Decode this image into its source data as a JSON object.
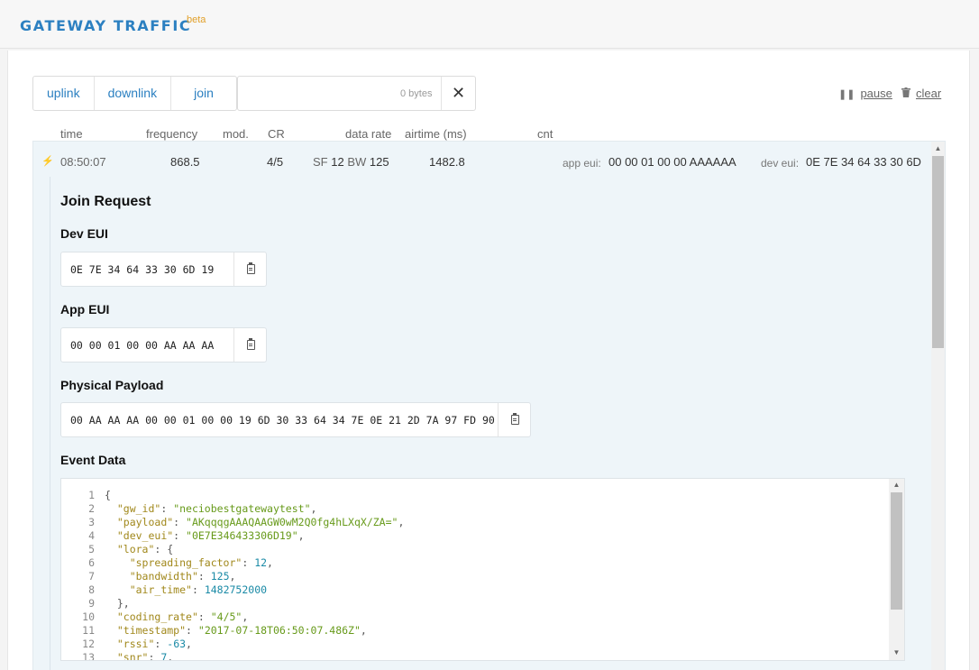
{
  "header": {
    "title": "GATEWAY TRAFFIC",
    "badge": "beta"
  },
  "filters": [
    {
      "label": "uplink"
    },
    {
      "label": "downlink"
    },
    {
      "label": "join"
    }
  ],
  "bytes_filter": {
    "placeholder": "0 bytes",
    "clear_glyph": "✕"
  },
  "toolbar": {
    "pause_label": "pause",
    "clear_label": "clear",
    "pause_icon": "pause-icon",
    "clear_icon": "trash-icon"
  },
  "columns": {
    "time": "time",
    "frequency": "frequency",
    "mod": "mod.",
    "cr": "CR",
    "data_rate": "data rate",
    "airtime": "airtime (ms)",
    "cnt": "cnt"
  },
  "row": {
    "icon": "bolt-icon",
    "time": "08:50:07",
    "frequency": "868.5",
    "cr": "4/5",
    "sf_label": "SF",
    "sf_value": "12",
    "bw_label": "BW",
    "bw_value": "125",
    "airtime": "1482.8",
    "app_eui_label": "app eui:",
    "app_eui": "00 00 01 00 00 AAAAAA",
    "dev_eui_label": "dev eui:",
    "dev_eui": "0E 7E 34 64 33 30 6D"
  },
  "detail": {
    "title": "Join Request",
    "dev_eui_title": "Dev EUI",
    "dev_eui_value": "0E 7E 34 64 33 30 6D 19",
    "app_eui_title": "App EUI",
    "app_eui_value": "00 00 01 00 00 AA AA AA",
    "payload_title": "Physical Payload",
    "payload_value": "00 AA AA AA 00 00 01 00 00 19 6D 30 33 64 34 7E 0E 21 2D 7A 97 FD 90",
    "event_title": "Event Data"
  },
  "event_json": [
    {
      "n": "1",
      "text": "{"
    },
    {
      "n": "2",
      "key": "\"gw_id\"",
      "val": "\"neciobestgatewaytest\"",
      "vt": "str",
      "indent": 2,
      "comma": true
    },
    {
      "n": "3",
      "key": "\"payload\"",
      "val": "\"AKqqqgAAAQAAGW0wM2Q0fg4hLXqX/ZA=\"",
      "vt": "str",
      "indent": 2,
      "comma": true
    },
    {
      "n": "4",
      "key": "\"dev_eui\"",
      "val": "\"0E7E346433306D19\"",
      "vt": "str",
      "indent": 2,
      "comma": true
    },
    {
      "n": "5",
      "key": "\"lora\"",
      "val": "{",
      "vt": "p",
      "indent": 2,
      "comma": false
    },
    {
      "n": "6",
      "key": "\"spreading_factor\"",
      "val": "12",
      "vt": "num",
      "indent": 4,
      "comma": true
    },
    {
      "n": "7",
      "key": "\"bandwidth\"",
      "val": "125",
      "vt": "num",
      "indent": 4,
      "comma": true
    },
    {
      "n": "8",
      "key": "\"air_time\"",
      "val": "1482752000",
      "vt": "num",
      "indent": 4,
      "comma": false
    },
    {
      "n": "9",
      "text": "  },",
      "indent": 0
    },
    {
      "n": "10",
      "key": "\"coding_rate\"",
      "val": "\"4/5\"",
      "vt": "str",
      "indent": 2,
      "comma": true
    },
    {
      "n": "11",
      "key": "\"timestamp\"",
      "val": "\"2017-07-18T06:50:07.486Z\"",
      "vt": "str",
      "indent": 2,
      "comma": true
    },
    {
      "n": "12",
      "key": "\"rssi\"",
      "val": "-63",
      "vt": "num",
      "indent": 2,
      "comma": true
    },
    {
      "n": "13",
      "key": "\"snr\"",
      "val": "7",
      "vt": "num",
      "indent": 2,
      "comma": true
    }
  ]
}
